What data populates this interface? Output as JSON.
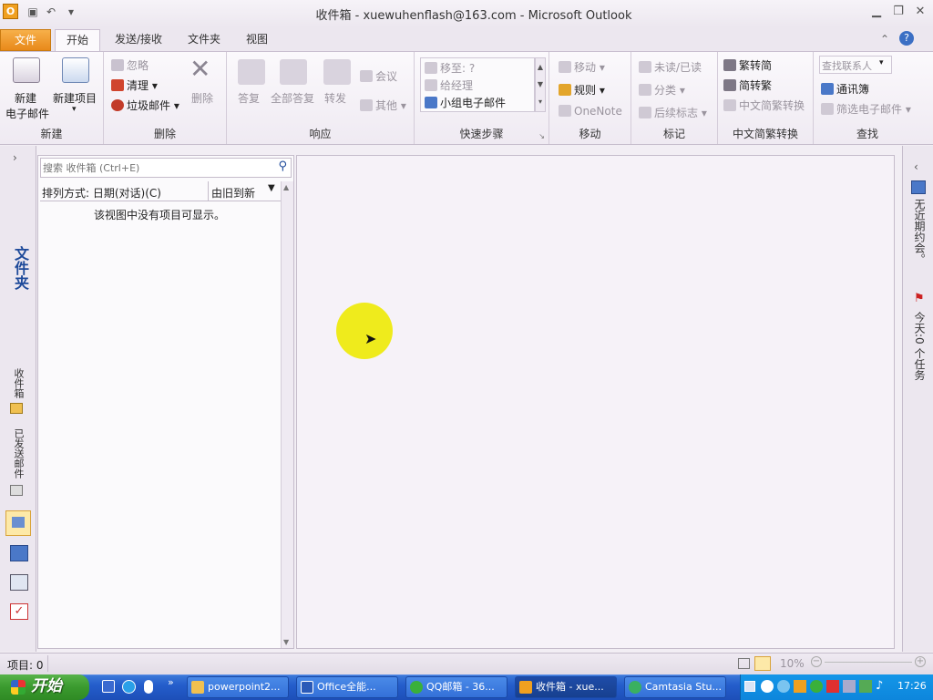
{
  "window": {
    "title": "收件箱 - xuewuhenflash@163.com - Microsoft Outlook",
    "app_icon": "O"
  },
  "tabs": [
    "文件",
    "开始",
    "发送/接收",
    "文件夹",
    "视图"
  ],
  "ribbon": {
    "new": {
      "new_email_l1": "新建",
      "new_email_l2": "电子邮件",
      "new_item": "新建项目",
      "label": "新建"
    },
    "delete": {
      "ignore": "忽略",
      "cleanup": "清理",
      "junk": "垃圾邮件",
      "delete": "删除",
      "label": "删除"
    },
    "respond": {
      "reply": "答复",
      "reply_all": "全部答复",
      "forward": "转发",
      "meeting": "会议",
      "more": "其他",
      "label": "响应"
    },
    "quicksteps": {
      "move_to": "移至: ?",
      "to_manager": "给经理",
      "team_email": "小组电子邮件",
      "label": "快速步骤"
    },
    "move": {
      "move": "移动",
      "rules": "规则",
      "onenote": "OneNote",
      "label": "移动"
    },
    "tags": {
      "unread_read": "未读/已读",
      "categorize": "分类",
      "followup": "后续标志",
      "label": "标记"
    },
    "chinese": {
      "to_trad": "繁转简",
      "to_simp": "简转繁",
      "convert": "中文简繁转换",
      "label": "中文简繁转换"
    },
    "find": {
      "search_contacts": "查找联系人",
      "address_book": "通讯簿",
      "filter": "筛选电子邮件",
      "label": "查找"
    }
  },
  "leftnav": {
    "folders_label": "文件夹",
    "inbox": "收件箱",
    "sent": "已发送邮件"
  },
  "list": {
    "search_placeholder": "搜索 收件箱 (Ctrl+E)",
    "sort_label": "排列方式: 日期(对话)(C)",
    "order_label": "由旧到新",
    "empty_message": "该视图中没有项目可显示。"
  },
  "todobar": {
    "appointments": "无近期约会。",
    "tasks": "今天:0 个任务"
  },
  "status": {
    "items": "项目: 0",
    "zoom": "10%"
  },
  "taskbar": {
    "start": "开始",
    "tasks": [
      "powerpoint2...",
      "Office全能...",
      "QQ邮箱 - 36...",
      "收件箱 - xue...",
      "Camtasia Stu..."
    ],
    "clock": "17:26"
  }
}
